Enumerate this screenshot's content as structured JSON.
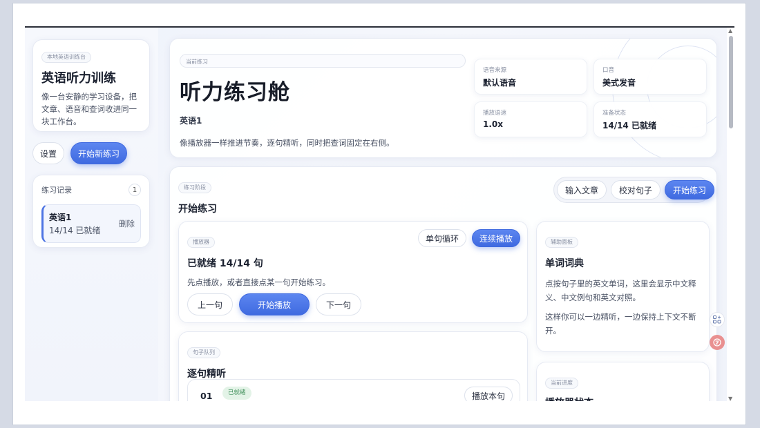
{
  "sidebar": {
    "tag": "本地英语训练台",
    "title": "英语听力训练",
    "description": "像一台安静的学习设备，把文章、语音和查词收进同一块工作台。",
    "settings_label": "设置",
    "new_practice_label": "开始新练习",
    "history": {
      "title": "练习记录",
      "count": "1",
      "items": [
        {
          "name": "英语1",
          "status": "14/14 已就绪",
          "delete_label": "删除"
        }
      ]
    }
  },
  "hero": {
    "tag": "当前练习",
    "title": "听力练习舱",
    "subtitle": "英语1",
    "description": "像播放器一样推进节奏，逐句精听，同时把查词固定在右侧。",
    "stats": [
      {
        "label": "语音来源",
        "value": "默认语音"
      },
      {
        "label": "口音",
        "value": "美式发音"
      },
      {
        "label": "播放语速",
        "value": "1.0x"
      },
      {
        "label": "准备状态",
        "value": "14/14 已就绪"
      }
    ]
  },
  "main": {
    "tag": "练习阶段",
    "title": "开始练习",
    "steps": [
      "输入文章",
      "校对句子",
      "开始练习"
    ],
    "player": {
      "tag": "播放器",
      "title": "已就绪 14/14 句",
      "description": "先点播放，或者直接点某一句开始练习。",
      "mode_single": "单句循环",
      "mode_continuous": "连续播放",
      "prev_label": "上一句",
      "play_label": "开始播放",
      "next_label": "下一句"
    },
    "queue": {
      "tag": "句子队列",
      "title": "逐句精听",
      "rows": [
        {
          "num": "01",
          "status": "已就绪",
          "play_label": "播放本句"
        }
      ]
    },
    "dictionary": {
      "tag": "辅助面板",
      "title": "单词词典",
      "p1": "点按句子里的英文单词，这里会显示中文释义、中文例句和英文对照。",
      "p2": "这样你可以一边精听，一边保持上下文不断开。"
    },
    "progress": {
      "tag": "当前进度",
      "title": "播放器状态"
    }
  },
  "colors": {
    "accent": "#4d74e3",
    "ready_green": "#3f8f5a"
  }
}
